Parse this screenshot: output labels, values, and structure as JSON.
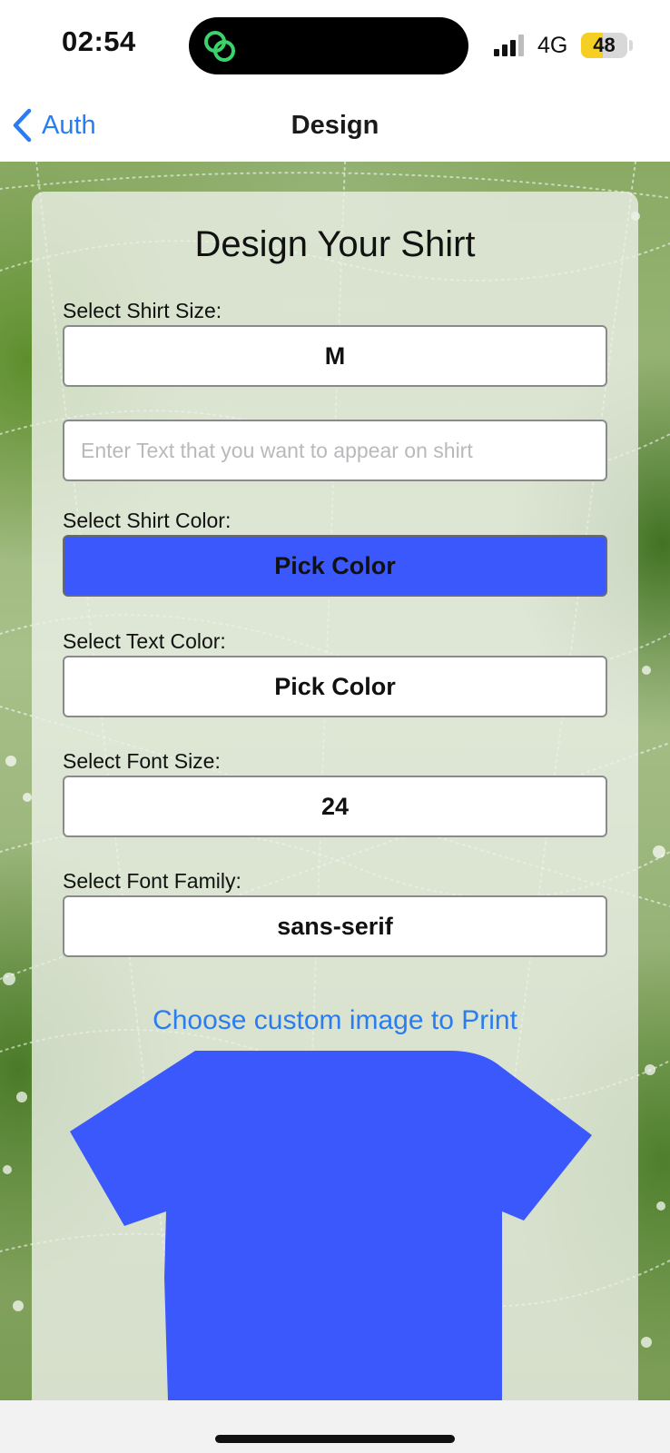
{
  "status_bar": {
    "time": "02:54",
    "network": "4G",
    "battery_level": "48",
    "battery_fraction": 0.48,
    "island_icon": "chat-link-icon",
    "signal_icon": "cellular-signal-icon"
  },
  "nav": {
    "back_label": "Auth",
    "back_icon": "chevron-left-icon",
    "title": "Design"
  },
  "form": {
    "title": "Design Your Shirt",
    "size_label": "Select Shirt Size:",
    "size_value": "M",
    "text_placeholder": "Enter Text that you want to appear on shirt",
    "shirt_color_label": "Select Shirt Color:",
    "shirt_color_button": "Pick Color",
    "shirt_color": "#3a58fb",
    "text_color_label": "Select Text Color:",
    "text_color_button": "Pick Color",
    "font_size_label": "Select Font Size:",
    "font_size_value": "24",
    "font_family_label": "Select Font Family:",
    "font_family_value": "sans-serif",
    "custom_image_link": "Choose custom image to Print"
  },
  "colors": {
    "accent_link": "#2a7df0",
    "shirt_preview": "#3a58fb"
  }
}
